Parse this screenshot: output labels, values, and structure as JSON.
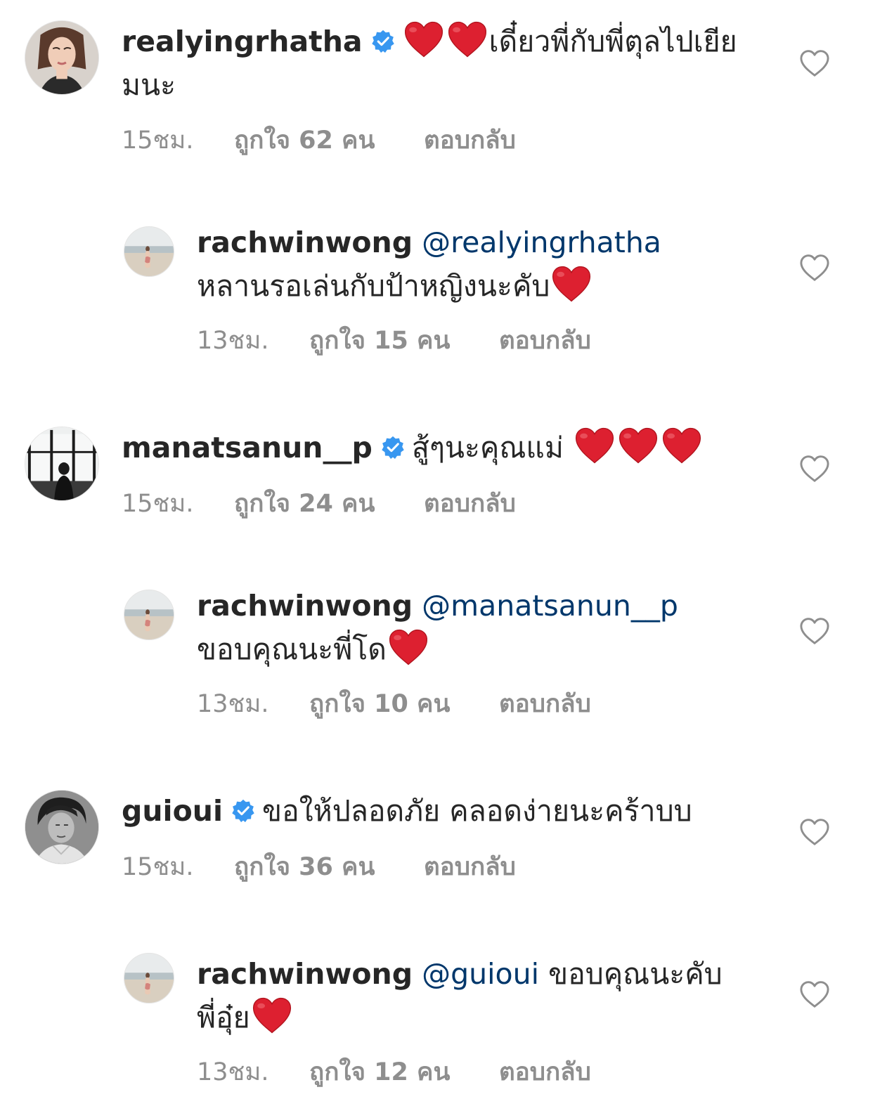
{
  "comments": [
    {
      "username": "realyingrhatha",
      "verified": true,
      "text": "เดี๋ยวพี่กับพี่ตุลไปเยียมนะ",
      "emoji_before": 2,
      "time": "15ชม.",
      "likes": "ถูกใจ 62 คน",
      "reply_label": "ตอบกลับ",
      "avatar": "woman-portrait-avatar"
    },
    {
      "username": "rachwinwong",
      "mention": "@realyingrhatha",
      "text": "หลานรอเล่นกับป้าหญิงนะคับ",
      "time": "13ชม.",
      "likes": "ถูกใจ 15 คน",
      "reply_label": "ตอบกลับ",
      "avatar": "beach-avatar"
    },
    {
      "username": "manatsanun__p",
      "verified": true,
      "text": "สู้ๆนะคุณแม่",
      "time": "15ชม.",
      "likes": "ถูกใจ 24 คน",
      "reply_label": "ตอบกลับ",
      "avatar": "window-silhouette-avatar"
    },
    {
      "username": "rachwinwong",
      "mention": "@manatsanun__p",
      "text": "ขอบคุณนะพี่โด",
      "time": "13ชม.",
      "likes": "ถูกใจ 10 คน",
      "reply_label": "ตอบกลับ",
      "avatar": "beach-avatar"
    },
    {
      "username": "guioui",
      "verified": true,
      "text": "ขอให้ปลอดภัย คลอดง่ายนะคร้าบบ",
      "time": "15ชม.",
      "likes": "ถูกใจ 36 คน",
      "reply_label": "ตอบกลับ",
      "avatar": "bw-portrait-avatar"
    },
    {
      "username": "rachwinwong",
      "mention": "@guioui",
      "text_line1": "ขอบคุณนะคับ",
      "text_line2": "พี่อุ๋ย",
      "time": "13ชม.",
      "likes": "ถูกใจ 12 คน",
      "reply_label": "ตอบกลับ",
      "avatar": "beach-avatar"
    }
  ],
  "icons": {
    "verified": "verified-badge-icon",
    "like": "heart-outline-icon",
    "emoji": "red-heart-emoji"
  },
  "colors": {
    "text": "#262626",
    "secondary": "#8e8e8e",
    "mention": "#00376b",
    "verified": "#3897f0",
    "emoji_heart": "#e0242f"
  }
}
